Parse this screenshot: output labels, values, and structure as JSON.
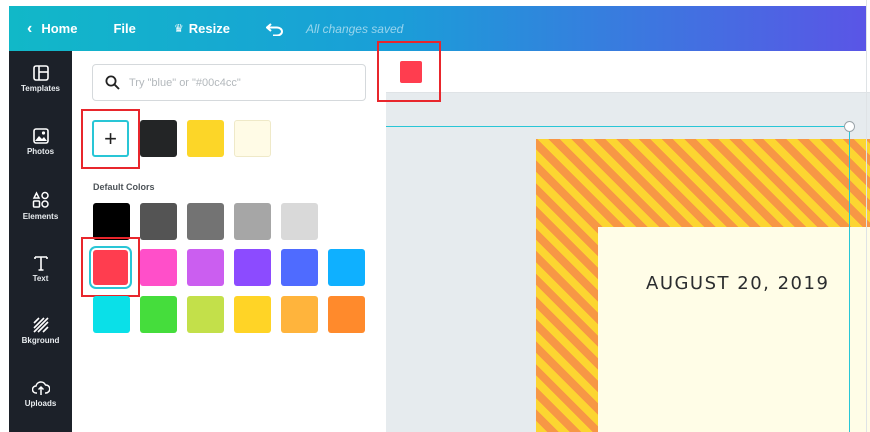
{
  "topbar": {
    "home_label": "Home",
    "file_label": "File",
    "resize_label": "Resize",
    "saved_status": "All changes saved"
  },
  "sidebar": {
    "items": [
      {
        "label": "Templates",
        "icon": "templates-icon"
      },
      {
        "label": "Photos",
        "icon": "photos-icon"
      },
      {
        "label": "Elements",
        "icon": "elements-icon"
      },
      {
        "label": "Text",
        "icon": "text-icon"
      },
      {
        "label": "Bkground",
        "icon": "background-icon"
      },
      {
        "label": "Uploads",
        "icon": "uploads-icon"
      }
    ]
  },
  "panel": {
    "search_placeholder": "Try \"blue\" or \"#00c4cc\"",
    "add_label": "+",
    "document_colors": [
      "#232526",
      "#fcd628",
      "#fffbe6"
    ],
    "default_colors_label": "Default Colors",
    "default_colors": [
      [
        "#000000",
        "#545454",
        "#737373",
        "#a6a6a6",
        "#d9d9d9"
      ],
      [
        "#ff3d4f",
        "#ff4fc9",
        "#cb5ef0",
        "#8c4bff",
        "#4f6bff",
        "#0fb0ff"
      ],
      [
        "#0ae0e8",
        "#45dd3c",
        "#c3e04a",
        "#ffd426",
        "#ffb43c",
        "#ff8a2c"
      ]
    ],
    "selected_color": "#ff3d4f"
  },
  "canvas": {
    "toolbar_color": "#ff3d4f",
    "date_text": "AUGUST 20, 2019"
  },
  "colors": {
    "accent": "#29c6d6",
    "highlight_box": "#e8262c",
    "sidebar_bg": "#1c2129"
  }
}
